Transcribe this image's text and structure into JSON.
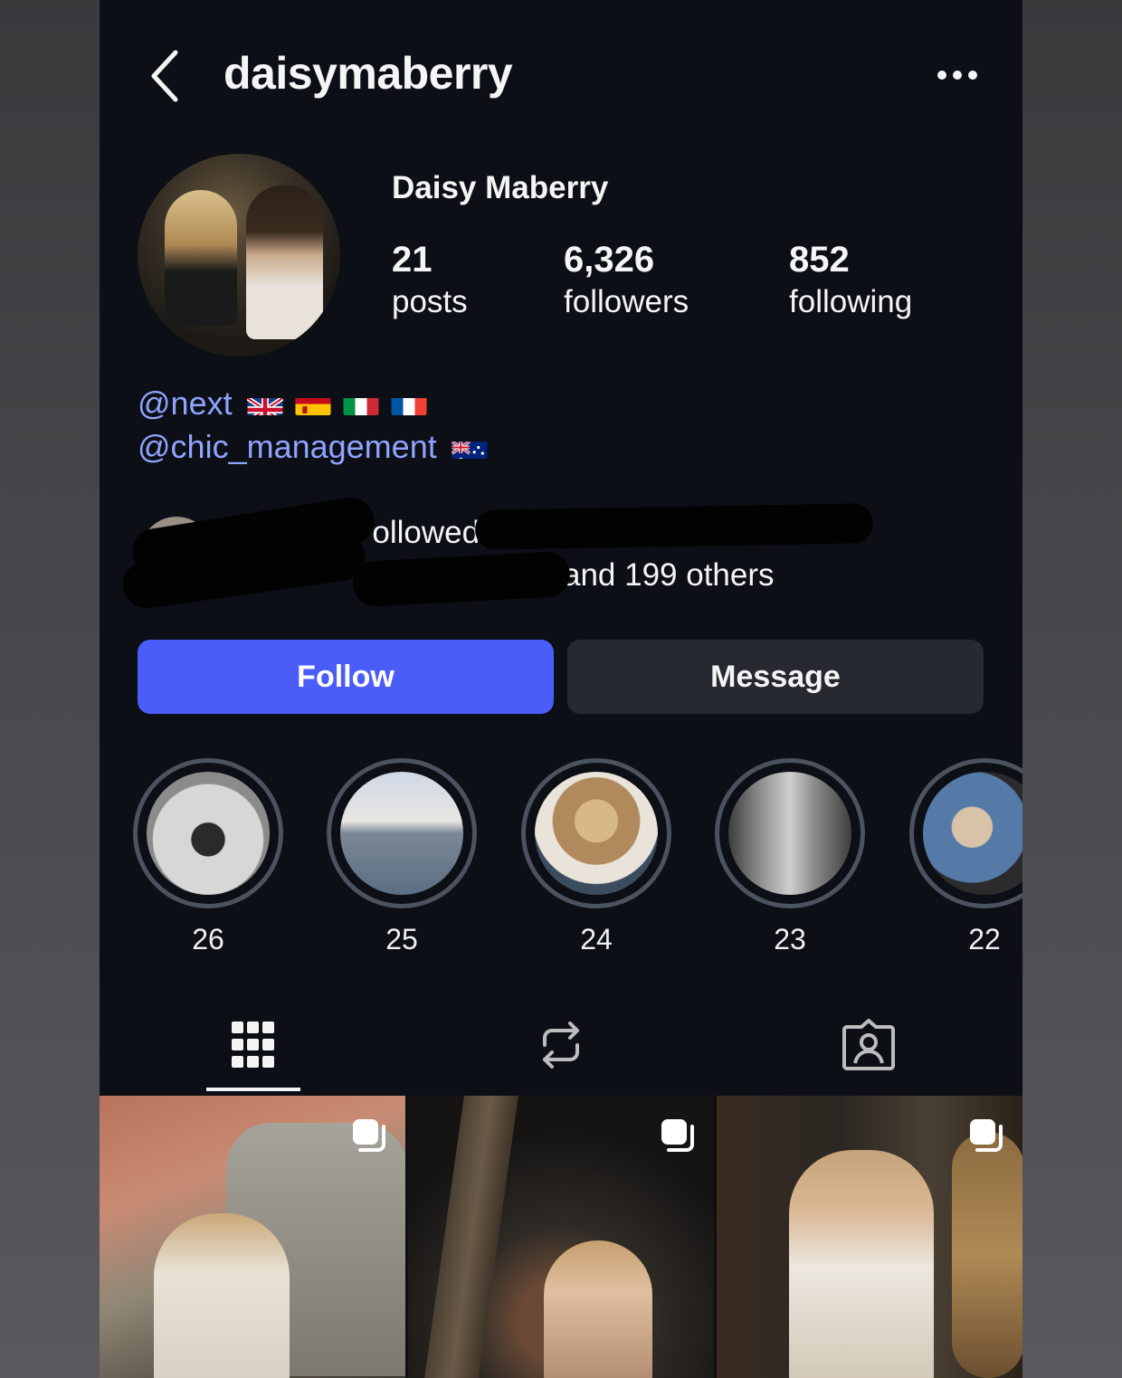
{
  "header": {
    "username": "daisymaberry"
  },
  "profile": {
    "display_name": "Daisy Maberry",
    "stats": [
      {
        "value": "21",
        "label": "posts"
      },
      {
        "value": "6,326",
        "label": "followers"
      },
      {
        "value": "852",
        "label": "following"
      }
    ],
    "bio": [
      {
        "handle": "@next",
        "flags": [
          "uk-flag",
          "spain-flag",
          "italy-flag",
          "france-flag"
        ]
      },
      {
        "handle": "@chic_management",
        "flags": [
          "australia-flag"
        ]
      }
    ],
    "followed_by": {
      "line1": "Followed",
      "line2_suffix": "and 199 others"
    }
  },
  "actions": {
    "follow_label": "Follow",
    "message_label": "Message"
  },
  "highlights": [
    {
      "label": "26"
    },
    {
      "label": "25"
    },
    {
      "label": "24"
    },
    {
      "label": "23"
    },
    {
      "label": "22"
    }
  ],
  "tabs": [
    "grid-icon",
    "reposts-icon",
    "tagged-icon"
  ],
  "colors": {
    "accent": "#4a5df9",
    "link": "#8fa3ff",
    "background": "#0c0f15",
    "secondary_button": "#26292f"
  }
}
